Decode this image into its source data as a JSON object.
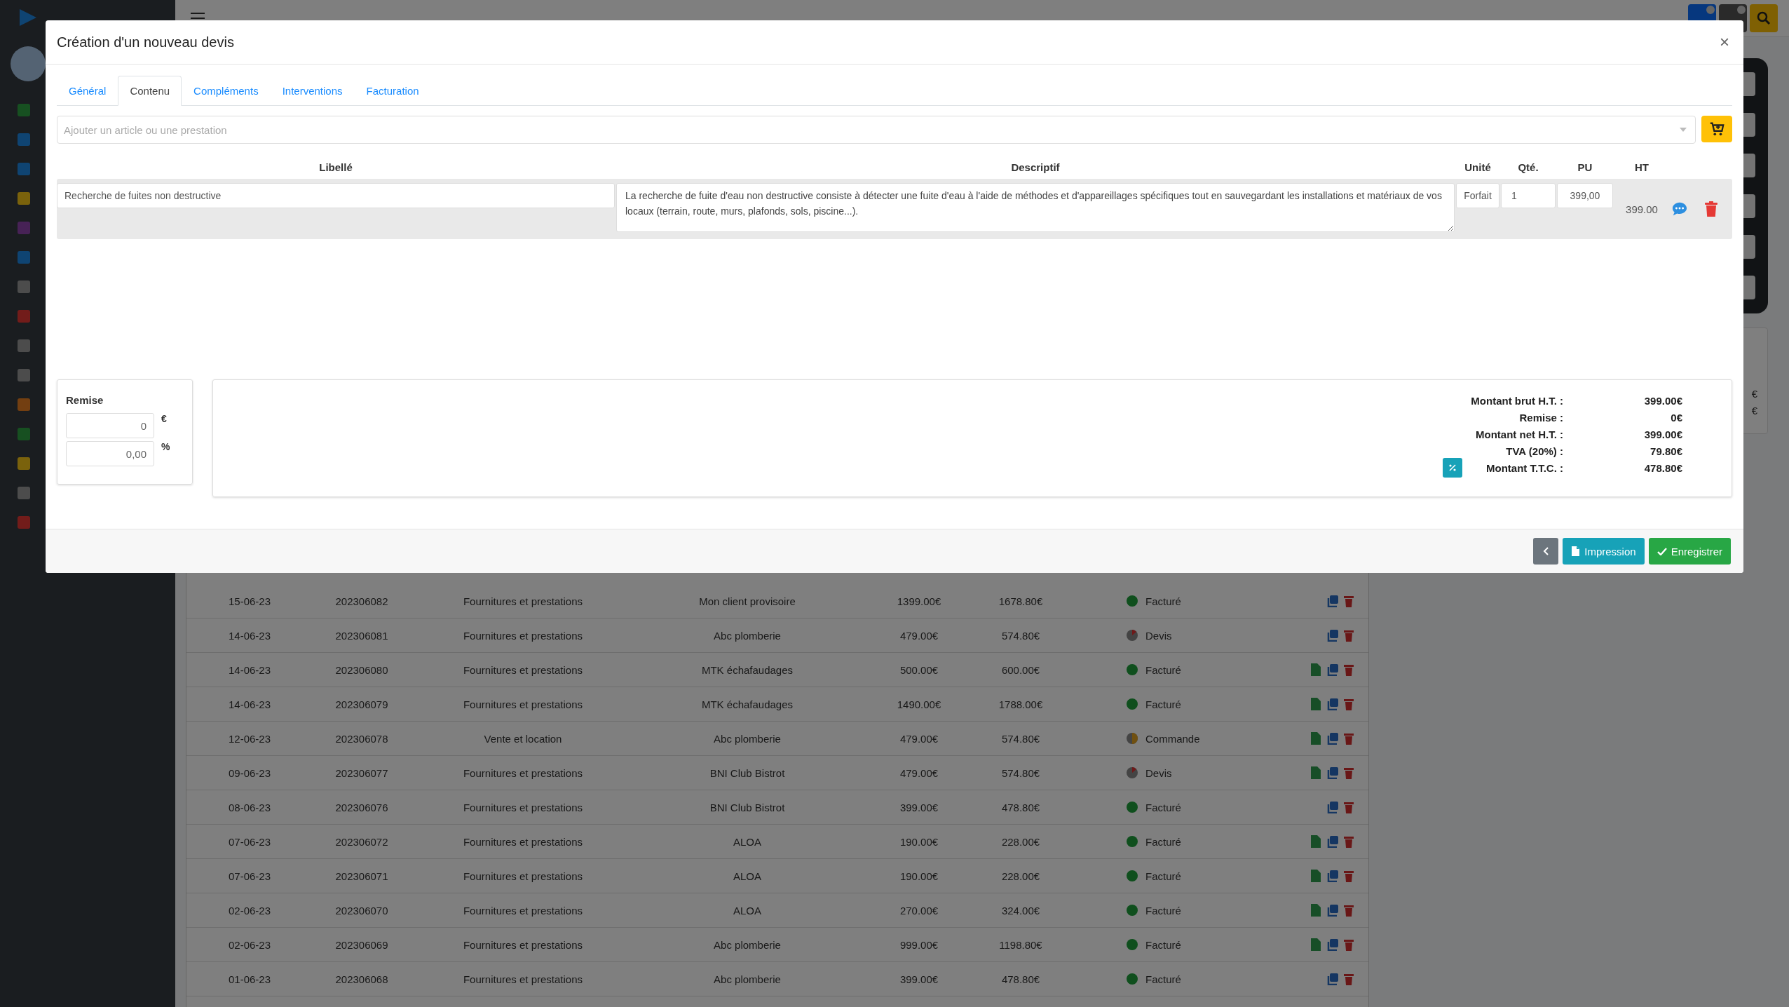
{
  "background_table": {
    "rows": [
      {
        "date": "15-06-23",
        "number": "202306082",
        "type": "Fournitures et prestations",
        "client": "Mon client provisoire",
        "amount_ht": "1399.00€",
        "amount_ttc": "1678.80€",
        "status": {
          "label": "Facturé",
          "kind": "invoiced"
        },
        "pdf": false
      },
      {
        "date": "14-06-23",
        "number": "202306081",
        "type": "Fournitures et prestations",
        "client": "Abc plomberie",
        "amount_ht": "479.00€",
        "amount_ttc": "574.80€",
        "status": {
          "label": "Devis",
          "kind": "quote"
        },
        "pdf": false
      },
      {
        "date": "14-06-23",
        "number": "202306080",
        "type": "Fournitures et prestations",
        "client": "MTK échafaudages",
        "amount_ht": "500.00€",
        "amount_ttc": "600.00€",
        "status": {
          "label": "Facturé",
          "kind": "invoiced"
        },
        "pdf": true
      },
      {
        "date": "14-06-23",
        "number": "202306079",
        "type": "Fournitures et prestations",
        "client": "MTK échafaudages",
        "amount_ht": "1490.00€",
        "amount_ttc": "1788.00€",
        "status": {
          "label": "Facturé",
          "kind": "invoiced"
        },
        "pdf": true
      },
      {
        "date": "12-06-23",
        "number": "202306078",
        "type": "Vente et location",
        "client": "Abc plomberie",
        "amount_ht": "479.00€",
        "amount_ttc": "574.80€",
        "status": {
          "label": "Commande",
          "kind": "order"
        },
        "pdf": true
      },
      {
        "date": "09-06-23",
        "number": "202306077",
        "type": "Fournitures et prestations",
        "client": "BNI Club Bistrot",
        "amount_ht": "479.00€",
        "amount_ttc": "574.80€",
        "status": {
          "label": "Devis",
          "kind": "quote"
        },
        "pdf": true
      },
      {
        "date": "08-06-23",
        "number": "202306076",
        "type": "Fournitures et prestations",
        "client": "BNI Club Bistrot",
        "amount_ht": "399.00€",
        "amount_ttc": "478.80€",
        "status": {
          "label": "Facturé",
          "kind": "invoiced"
        },
        "pdf": false
      },
      {
        "date": "07-06-23",
        "number": "202306072",
        "type": "Fournitures et prestations",
        "client": "ALOA",
        "amount_ht": "190.00€",
        "amount_ttc": "228.00€",
        "status": {
          "label": "Facturé",
          "kind": "invoiced"
        },
        "pdf": true
      },
      {
        "date": "07-06-23",
        "number": "202306071",
        "type": "Fournitures et prestations",
        "client": "ALOA",
        "amount_ht": "190.00€",
        "amount_ttc": "228.00€",
        "status": {
          "label": "Facturé",
          "kind": "invoiced"
        },
        "pdf": true
      },
      {
        "date": "02-06-23",
        "number": "202306070",
        "type": "Fournitures et prestations",
        "client": "ALOA",
        "amount_ht": "270.00€",
        "amount_ttc": "324.00€",
        "status": {
          "label": "Facturé",
          "kind": "invoiced"
        },
        "pdf": true
      },
      {
        "date": "02-06-23",
        "number": "202306069",
        "type": "Fournitures et prestations",
        "client": "Abc plomberie",
        "amount_ht": "999.00€",
        "amount_ttc": "1198.80€",
        "status": {
          "label": "Facturé",
          "kind": "invoiced"
        },
        "pdf": true
      },
      {
        "date": "01-06-23",
        "number": "202306068",
        "type": "Fournitures et prestations",
        "client": "Abc plomberie",
        "amount_ht": "399.00€",
        "amount_ttc": "478.80€",
        "status": {
          "label": "Facturé",
          "kind": "invoiced"
        },
        "pdf": false
      }
    ]
  },
  "side_panel": {
    "values": [
      "€",
      "€"
    ]
  },
  "dialog": {
    "title": "Création d'un nouveau devis",
    "close": "×",
    "tabs": [
      {
        "label": "Général",
        "selected": false
      },
      {
        "label": "Contenu",
        "selected": true
      },
      {
        "label": "Compléments",
        "selected": false
      },
      {
        "label": "Interventions",
        "selected": false
      },
      {
        "label": "Facturation",
        "selected": false
      }
    ],
    "search": {
      "placeholder": "Ajouter un article ou une prestation"
    },
    "columns": [
      "Libellé",
      "Descriptif",
      "Unité",
      "Qté.",
      "PU",
      "HT"
    ],
    "lines": [
      {
        "label": "Recherche de fuites non destructive",
        "description": "La recherche de fuite d'eau non destructive consiste à détecter une fuite d'eau à l'aide de méthodes et d'appareillages spécifiques tout en sauvegardant les installations et matériaux de vos locaux (terrain, route, murs, plafonds, sols, piscine...).",
        "unit": "Forfait",
        "qty": "1",
        "price": "399,00",
        "total": "399.00"
      }
    ],
    "discount": {
      "title": "Remise",
      "amount": "0",
      "amount_unit": "€",
      "percent": "0,00",
      "percent_unit": "%"
    },
    "totals": [
      {
        "label": "Montant brut H.T. :",
        "value": "399.00€"
      },
      {
        "label": "Remise :",
        "value": "0€"
      },
      {
        "label": "Montant net H.T. :",
        "value": "399.00€"
      },
      {
        "label": "TVA (20%) :",
        "value": "79.80€"
      },
      {
        "label": "Montant T.T.C. :",
        "value": "478.80€",
        "button": true
      }
    ],
    "buttons": [
      {
        "kind": "back"
      },
      {
        "kind": "print",
        "label": "Impression"
      },
      {
        "kind": "save",
        "label": "Enregistrer"
      }
    ]
  }
}
